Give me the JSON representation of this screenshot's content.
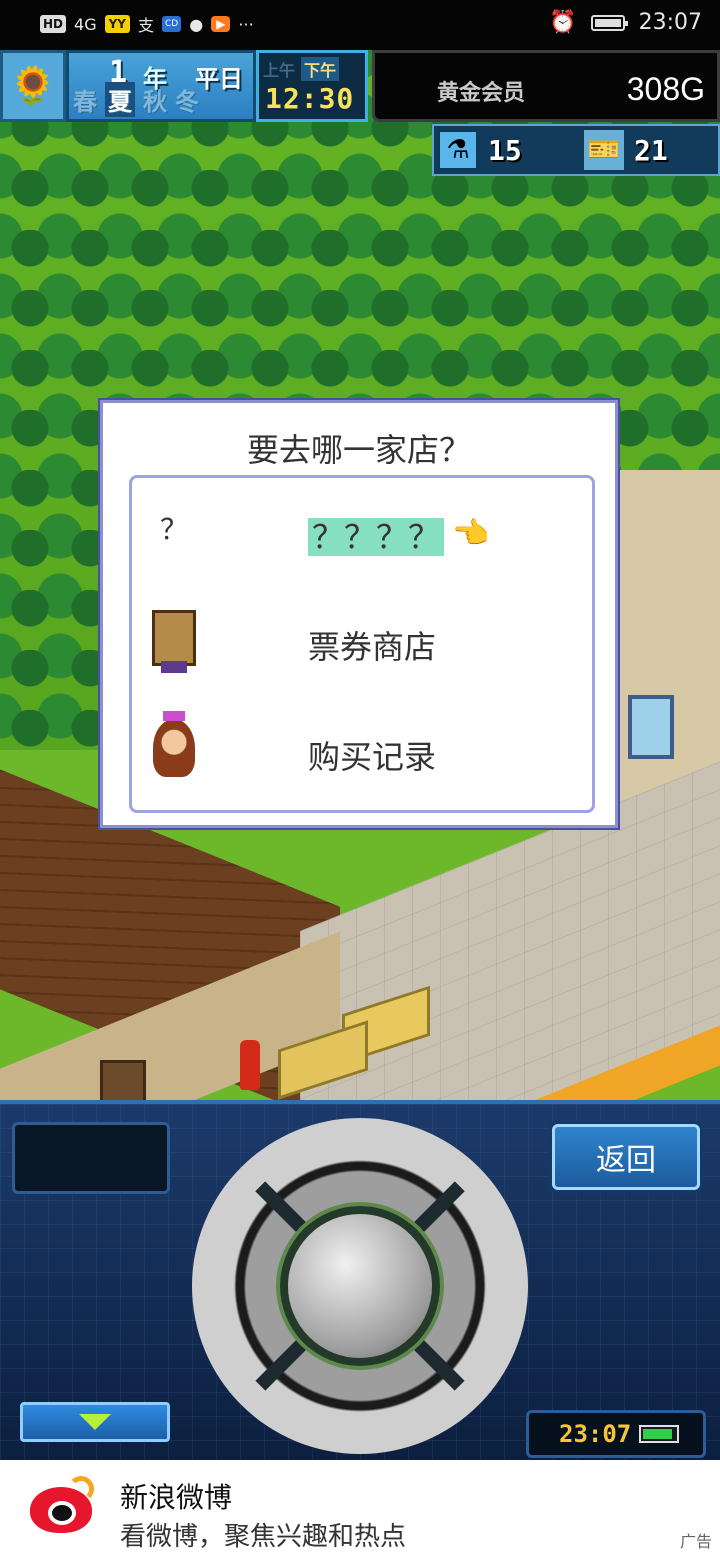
{
  "status_bar": {
    "hd": "HD",
    "signal": "4G",
    "more": "···",
    "time": "23:07"
  },
  "hud": {
    "year_num": "1",
    "year_unit": "年",
    "day_type": "平日",
    "seasons": [
      "春",
      "夏",
      "秋",
      "冬"
    ],
    "active_season_index": 1,
    "am": "上午",
    "pm": "下午",
    "clock": "12:30",
    "member": "黄金会员",
    "money": "308G",
    "flask_count": "15",
    "ticket_count": "21"
  },
  "dialog": {
    "title": "要去哪一家店？",
    "options": [
      {
        "icon_text": "？",
        "label": "？？？？",
        "selected": true
      },
      {
        "icon_text": "",
        "label": "票券商店",
        "selected": false
      },
      {
        "icon_text": "",
        "label": "购买记录",
        "selected": false
      }
    ]
  },
  "controls": {
    "back_label": "返回",
    "clock": "23:07"
  },
  "ad": {
    "title": "新浪微博",
    "subtitle": "看微博，聚焦兴趣和热点",
    "tag": "广告"
  },
  "colors": {
    "highlight": "#86dfc0",
    "dialog_border": "#8c8fd2",
    "panel_blue": "#1c3a6a"
  }
}
